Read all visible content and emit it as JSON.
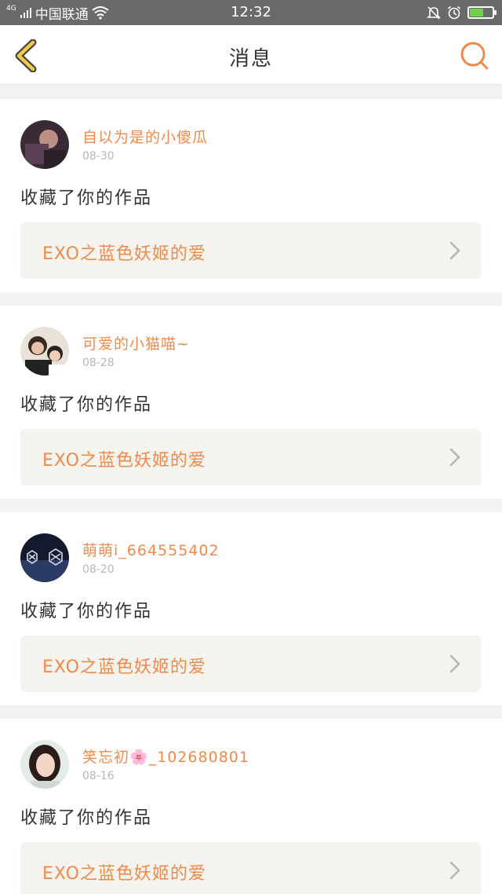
{
  "status_bar": {
    "network": "4G",
    "carrier": "中国联通",
    "time": "12:32",
    "battery_level": 0.55,
    "icons": [
      "signal-icon",
      "wifi-icon",
      "bell-muted-icon",
      "alarm-icon",
      "battery-icon"
    ]
  },
  "header": {
    "title": "消息",
    "back_icon": "chevron-left-icon",
    "search_icon": "search-icon"
  },
  "colors": {
    "accent": "#f08a4b",
    "back_arrow": "#f2c94c",
    "card_bg": "#ffffff",
    "work_bg": "#f4f3ee",
    "page_bg": "#f2f2f2"
  },
  "messages": [
    {
      "username": "自以为是的小傻瓜",
      "date": "08-30",
      "action": "收藏了你的作品",
      "work_title": "EXO之蓝色妖姬的爱",
      "avatar": "avatar-photo-dark"
    },
    {
      "username": "可爱的小猫喵~",
      "date": "08-28",
      "action": "收藏了你的作品",
      "work_title": "EXO之蓝色妖姬的爱",
      "avatar": "avatar-photo-kids"
    },
    {
      "username": "萌萌i_664555402",
      "date": "08-20",
      "action": "收藏了你的作品",
      "work_title": "EXO之蓝色妖姬的爱",
      "avatar": "avatar-exo-logo"
    },
    {
      "username": "笑忘初🌸_102680801",
      "date": "08-16",
      "action": "收藏了你的作品",
      "work_title": "EXO之蓝色妖姬的爱",
      "avatar": "avatar-photo-woman"
    }
  ]
}
